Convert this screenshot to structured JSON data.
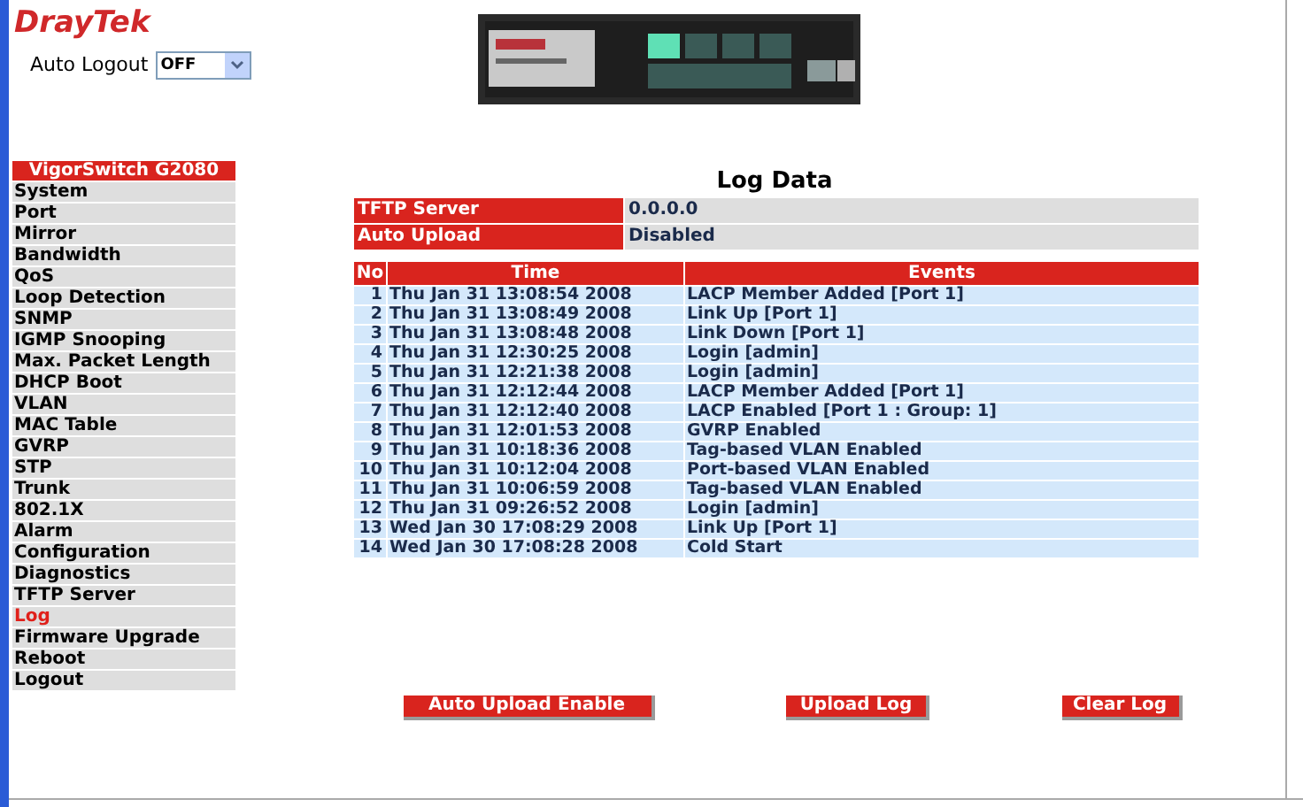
{
  "logo": "DrayTek",
  "auto_logout": {
    "label": "Auto Logout",
    "value": "OFF"
  },
  "sidebar": {
    "title": "VigorSwitch G2080",
    "items": [
      {
        "label": "System",
        "selected": false
      },
      {
        "label": "Port",
        "selected": false
      },
      {
        "label": "Mirror",
        "selected": false
      },
      {
        "label": "Bandwidth",
        "selected": false
      },
      {
        "label": "QoS",
        "selected": false
      },
      {
        "label": "Loop Detection",
        "selected": false
      },
      {
        "label": "SNMP",
        "selected": false
      },
      {
        "label": "IGMP Snooping",
        "selected": false
      },
      {
        "label": "Max. Packet Length",
        "selected": false
      },
      {
        "label": "DHCP Boot",
        "selected": false
      },
      {
        "label": "VLAN",
        "selected": false
      },
      {
        "label": "MAC Table",
        "selected": false
      },
      {
        "label": "GVRP",
        "selected": false
      },
      {
        "label": "STP",
        "selected": false
      },
      {
        "label": "Trunk",
        "selected": false
      },
      {
        "label": "802.1X",
        "selected": false
      },
      {
        "label": "Alarm",
        "selected": false
      },
      {
        "label": "Configuration",
        "selected": false
      },
      {
        "label": "Diagnostics",
        "selected": false
      },
      {
        "label": "TFTP Server",
        "selected": false
      },
      {
        "label": "Log",
        "selected": true
      },
      {
        "label": "Firmware Upgrade",
        "selected": false
      },
      {
        "label": "Reboot",
        "selected": false
      },
      {
        "label": "Logout",
        "selected": false
      }
    ]
  },
  "title": "Log Data",
  "info": [
    {
      "label": "TFTP Server",
      "value": "0.0.0.0"
    },
    {
      "label": "Auto Upload",
      "value": "Disabled"
    }
  ],
  "table": {
    "columns": [
      "No",
      "Time",
      "Events"
    ],
    "rows": [
      [
        "1",
        "Thu Jan 31 13:08:54 2008",
        "LACP Member Added [Port 1]"
      ],
      [
        "2",
        "Thu Jan 31 13:08:49 2008",
        "Link Up [Port 1]"
      ],
      [
        "3",
        "Thu Jan 31 13:08:48 2008",
        "Link Down [Port 1]"
      ],
      [
        "4",
        "Thu Jan 31 12:30:25 2008",
        "Login [admin]"
      ],
      [
        "5",
        "Thu Jan 31 12:21:38 2008",
        "Login [admin]"
      ],
      [
        "6",
        "Thu Jan 31 12:12:44 2008",
        "LACP Member Added [Port 1]"
      ],
      [
        "7",
        "Thu Jan 31 12:12:40 2008",
        "LACP Enabled [Port 1 : Group: 1]"
      ],
      [
        "8",
        "Thu Jan 31 12:01:53 2008",
        "GVRP Enabled"
      ],
      [
        "9",
        "Thu Jan 31 10:18:36 2008",
        "Tag-based VLAN Enabled"
      ],
      [
        "10",
        "Thu Jan 31 10:12:04 2008",
        "Port-based VLAN Enabled"
      ],
      [
        "11",
        "Thu Jan 31 10:06:59 2008",
        "Tag-based VLAN Enabled"
      ],
      [
        "12",
        "Thu Jan 31 09:26:52 2008",
        "Login [admin]"
      ],
      [
        "13",
        "Wed Jan 30 17:08:29 2008",
        "Link Up [Port 1]"
      ],
      [
        "14",
        "Wed Jan 30 17:08:28 2008",
        "Cold Start"
      ]
    ]
  },
  "buttons": [
    "Auto Upload Enable",
    "Upload Log",
    "Clear Log"
  ]
}
